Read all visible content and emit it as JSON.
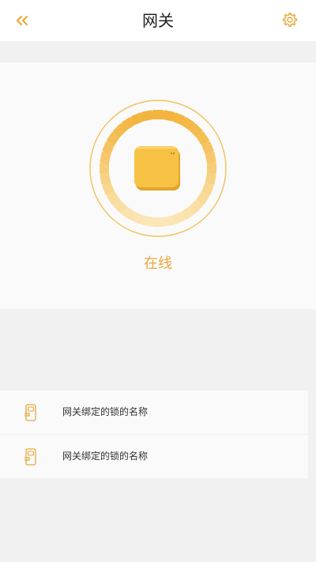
{
  "header": {
    "title": "网关",
    "back_icon": "double-chevron-left-icon",
    "settings_icon": "gear-icon"
  },
  "gateway": {
    "status": "在线",
    "device_icon": "gateway-device-icon"
  },
  "locks": [
    {
      "label": "网关绑定的锁的名称",
      "icon": "smart-lock-icon"
    },
    {
      "label": "网关绑定的锁的名称",
      "icon": "smart-lock-icon"
    }
  ],
  "colors": {
    "accent": "#e8a93a",
    "ring_dark": "#f2b43c",
    "ring_light": "#fbe6b7",
    "device": "#f7c244"
  }
}
